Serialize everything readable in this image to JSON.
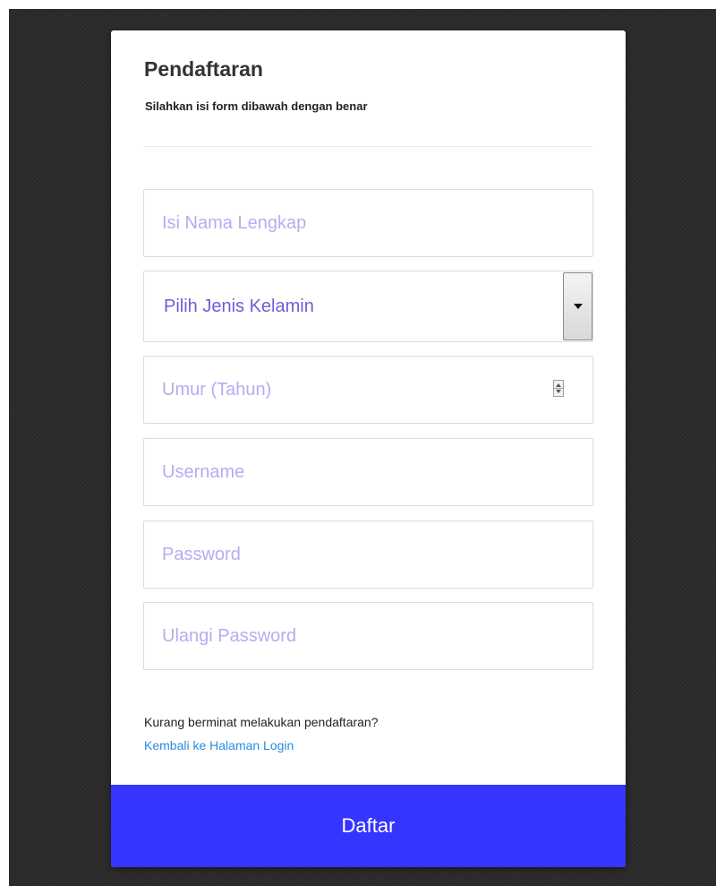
{
  "form": {
    "title": "Pendaftaran",
    "subtitle": "Silahkan isi form dibawah dengan benar",
    "fields": {
      "nama_lengkap": {
        "placeholder": "Isi Nama Lengkap",
        "value": ""
      },
      "jenis_kelamin": {
        "selected": "Pilih Jenis Kelamin"
      },
      "umur": {
        "placeholder": "Umur (Tahun)",
        "value": ""
      },
      "username": {
        "placeholder": "Username",
        "value": ""
      },
      "password": {
        "placeholder": "Password",
        "value": ""
      },
      "ulangi_password": {
        "placeholder": "Ulangi Password",
        "value": ""
      }
    },
    "footer_note": "Kurang berminat melakukan pendaftaran?",
    "login_link": "Kembali ke Halaman Login",
    "submit_label": "Daftar"
  },
  "colors": {
    "backdrop": "#2b2b2b",
    "card": "#ffffff",
    "accent": "#3535ff",
    "link": "#2a8be0",
    "placeholder": "#b3aef0",
    "select_text": "#6b5fd8"
  },
  "icons": {
    "select_arrow": "chevron-down-icon",
    "number_spinner": "spinner-icon"
  }
}
